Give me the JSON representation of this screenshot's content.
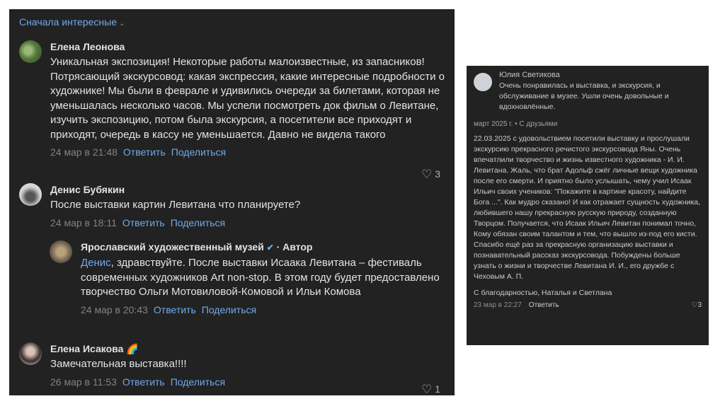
{
  "feed": {
    "sort_label": "Сначала интересные",
    "comments": [
      {
        "author": "Елена Леонова",
        "text": "Уникальная экспозиция! Некоторые работы малоизвестные, из запасников! Потрясающий экскурсовод: какая экспрессия, какие интересные подробности о художнике! Мы были в феврале и удивились очереди за билетами, которая не уменьшалась несколько часов. Мы успели посмотреть док фильм о Левитане, изучить экспозицию, потом была экскурсия, а посетители все приходят и приходят, очередь в кассу не уменьшается. Давно не видела такого",
        "date": "24 мар в 21:48",
        "reply_label": "Ответить",
        "share_label": "Поделиться",
        "likes": "3"
      },
      {
        "author": "Денис Бубякин",
        "text": "После выставки картин Левитана что планируете?",
        "date": "24 мар в 18:11",
        "reply_label": "Ответить",
        "share_label": "Поделиться"
      },
      {
        "author": "Ярославский художественный музей",
        "verified_icon": "✔",
        "author_tag": "· Автор",
        "mention": "Денис",
        "text": ", здравствуйте. После выставки Исаака Левитана – фестиваль современных художников Art non-stop. В этом году будет предоставлено творчество Ольги Мотовиловой-Комовой и Ильи Комова",
        "date": "24 мар в 20:43",
        "reply_label": "Ответить",
        "share_label": "Поделиться"
      },
      {
        "author": "Елена Исакова",
        "emoji": "🌈",
        "text": "Замечательная выставка!!!!",
        "date": "26 мар в 11:53",
        "reply_label": "Ответить",
        "share_label": "Поделиться",
        "likes": "1"
      }
    ]
  },
  "review": {
    "author": "Юлия Светикова",
    "summary": "Очень понравилась и выставка, и экскурсия, и обслуживание в музее. Ушли очень довольные и вдохновлённые.",
    "visit_info": "март 2025 г. • С друзьями",
    "body": "22.03.2025 с удовольствием посетили выставку и прослушали экскурсию прекрасного речистого экскурсовода Яны. Очень впечатлили творчество и жизнь известного художника - И. И. Левитана. Жаль, что брат Адольф сжёг личные вещи художника после его смерти. И приятно было услышать, чему учил Исаак Ильич своих учеников: \"Покажите в картине красоту, найдите Бога ...\". Как мудро сказано! И как отражает сущность художника, любившего нашу прекрасную русскую природу, созданную Творцом. Получается, что Исаак Ильич Левитан понимал точно, Кому обязан своим талантом и тем, что вышло из-под его кисти. Спасибо ещё раз за прекрасную организацию выставки и познавательный рассказ экскурсовода. Побуждены больше узнать о жизни и творчестве Левитана И. И., его дружбе с Чеховым А. П.",
    "signature": "С благодарностью, Наталья и Светлана",
    "date": "23 мар в 22:27",
    "reply_label": "Ответить",
    "likes": "3"
  },
  "icons": {
    "heart": "♡",
    "chevron_down": "⌄"
  },
  "colors": {
    "panel_bg": "#222222",
    "link": "#71aaeb",
    "text": "#e1e3e6",
    "muted": "#828282"
  }
}
